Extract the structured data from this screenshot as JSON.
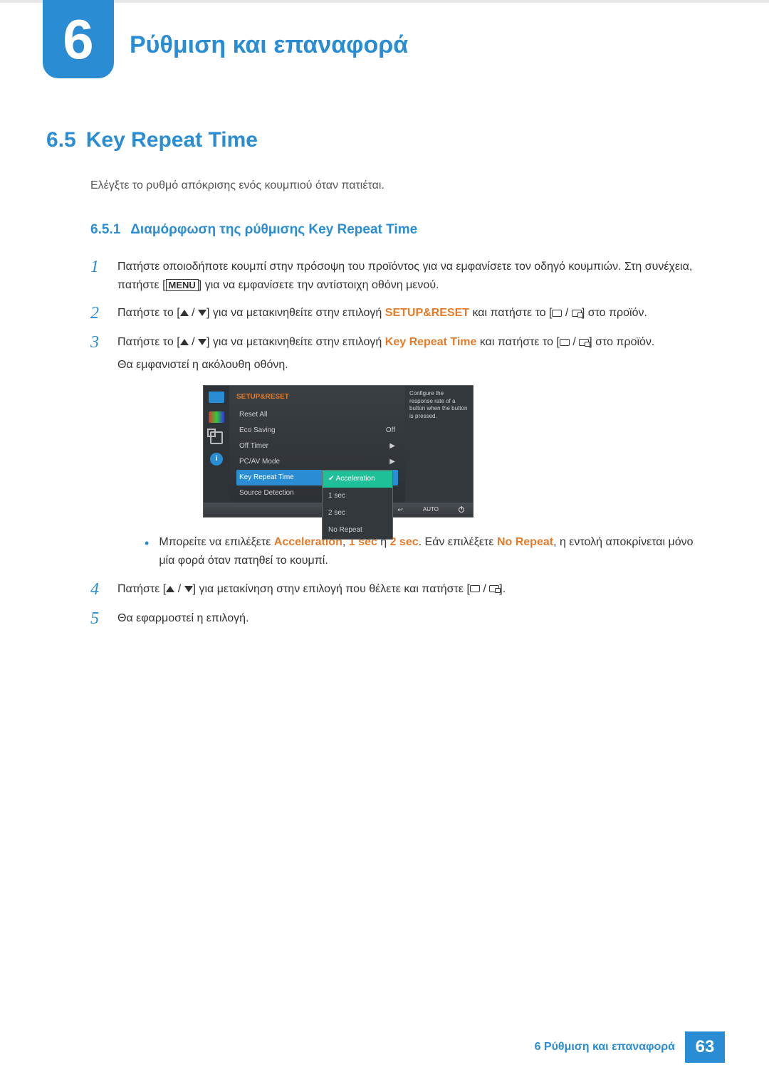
{
  "chapter": {
    "number": "6",
    "title": "Ρύθμιση και επαναφορά"
  },
  "section": {
    "number": "6.5",
    "title": "Key Repeat Time"
  },
  "intro": "Ελέγξτε το ρυθμό απόκρισης ενός κουμπιού όταν πατιέται.",
  "subsection": {
    "number": "6.5.1",
    "title": "Διαμόρφωση της ρύθμισης Key Repeat Time"
  },
  "steps": {
    "s1a": "Πατήστε οποιοδήποτε κουμπί στην πρόσοψη του προϊόντος για να εμφανίσετε τον οδηγό κουμπιών. Στη συνέχεια, πατήστε ",
    "s1_menu": "MENU",
    "s1b": " για να εμφανίσετε την αντίστοιχη οθόνη μενού.",
    "s2a": "Πατήστε το ",
    "s2b": " για να μετακινηθείτε στην επιλογή ",
    "s2_target": "SETUP&RESET",
    "s2c": " και πατήστε το ",
    "s2d": " στο προϊόν.",
    "s3a": "Πατήστε το ",
    "s3b": " για να μετακινηθείτε στην επιλογή ",
    "s3_target": "Key Repeat Time",
    "s3c": " και πατήστε το ",
    "s3d": " στο προϊόν.",
    "s3_after": "Θα εμφανιστεί η ακόλουθη οθόνη.",
    "bullet_a": "Μπορείτε να επιλέξετε ",
    "opt_accel": "Acceleration",
    "comma": ", ",
    "opt_1sec": "1 sec",
    "or": " ή ",
    "opt_2sec": "2 sec",
    "bullet_b": ". Εάν επιλέξετε ",
    "opt_norepeat": "No Repeat",
    "bullet_c": ", η εντολή αποκρίνεται μόνο μία φορά όταν πατηθεί το κουμπί.",
    "s4a": "Πατήστε ",
    "s4b": " για μετακίνηση στην επιλογή που θέλετε και πατήστε ",
    "s4c": ".",
    "s5": "Θα εφαρμοστεί η επιλογή."
  },
  "step_numbers": {
    "n1": "1",
    "n2": "2",
    "n3": "3",
    "n4": "4",
    "n5": "5"
  },
  "osd": {
    "header": "SETUP&RESET",
    "rows": {
      "reset": "Reset All",
      "eco": "Eco Saving",
      "eco_val": "Off",
      "offtimer": "Off Timer",
      "pcav": "PC/AV Mode",
      "krt": "Key Repeat Time",
      "source": "Source Detection"
    },
    "options": {
      "accel": "Acceleration",
      "sec1": "1 sec",
      "sec2": "2 sec",
      "norepeat": "No Repeat"
    },
    "info": "Configure the response rate of a button when the button is pressed.",
    "bottom_auto": "AUTO"
  },
  "footer": {
    "text": "6 Ρύθμιση και επαναφορά",
    "page": "63"
  }
}
